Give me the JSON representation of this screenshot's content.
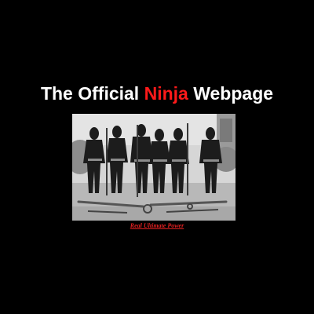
{
  "header": {
    "title_part1": "The Official ",
    "title_accent": "Ninja",
    "title_part2": " Webpage"
  },
  "colors": {
    "background": "#000000",
    "title_text": "#ffffff",
    "accent": "#ff1a1a",
    "link": "#e02020"
  },
  "footer": {
    "link_text": "Real Ultimate Power"
  }
}
